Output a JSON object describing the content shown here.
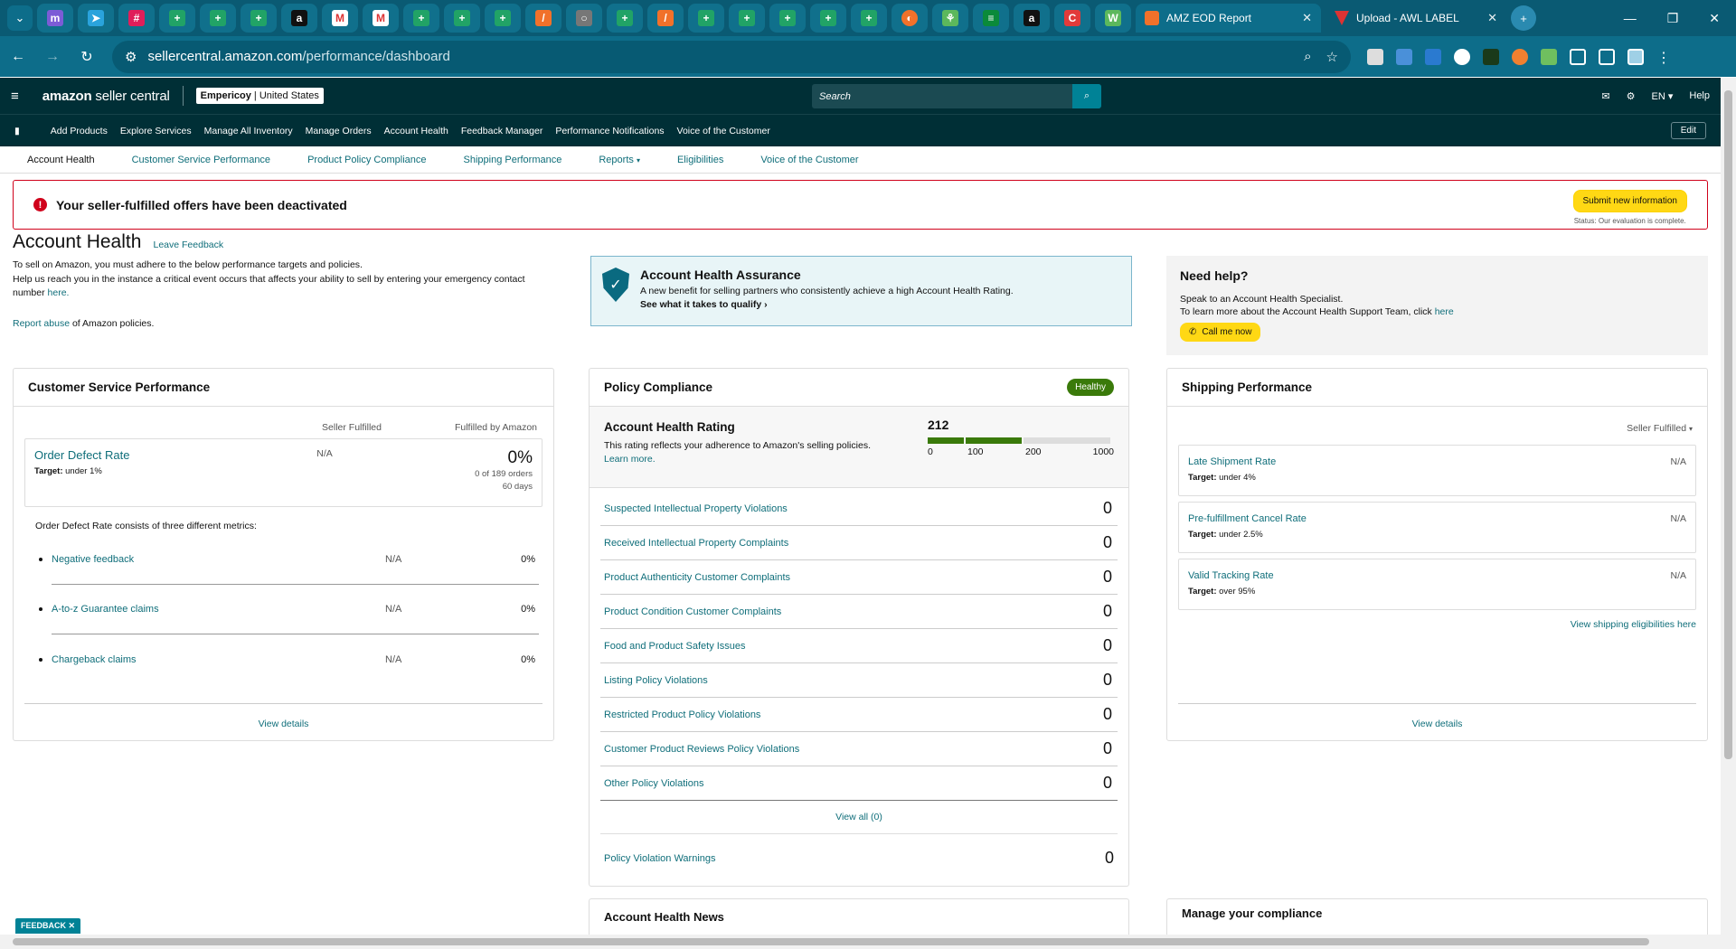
{
  "browser": {
    "tabs": [
      {
        "title": "AMZ EOD Report",
        "active": true
      },
      {
        "title": "Upload - AWL LABEL",
        "active": false
      }
    ],
    "url_domain": "sellercentral.amazon.com",
    "url_path": "/performance/dashboard"
  },
  "header": {
    "logo_main": "amazon",
    "logo_rest": " seller central",
    "account_name": "Empericoy",
    "account_region": "United States",
    "search_placeholder": "Search",
    "language": "EN",
    "help": "Help",
    "nav": [
      "Add Products",
      "Explore Services",
      "Manage All Inventory",
      "Manage Orders",
      "Account Health",
      "Feedback Manager",
      "Performance Notifications",
      "Voice of the Customer"
    ],
    "edit": "Edit"
  },
  "subnav": [
    "Account Health",
    "Customer Service Performance",
    "Product Policy Compliance",
    "Shipping Performance",
    "Reports",
    "Eligibilities",
    "Voice of the Customer"
  ],
  "banner": {
    "message": "Your seller-fulfilled offers have been deactivated",
    "button": "Submit new information",
    "status": "Status: Our evaluation is complete."
  },
  "intro": {
    "title": "Account Health",
    "leave_feedback": "Leave Feedback",
    "line1": "To sell on Amazon, you must adhere to the below performance targets and policies.",
    "line2": "Help us reach you in the instance a critical event occurs that affects your ability to sell by entering your emergency contact number ",
    "here": "here.",
    "report_abuse": "Report abuse",
    "report_rest": " of Amazon policies."
  },
  "aha": {
    "title": "Account Health Assurance",
    "text": "A new benefit for selling partners who consistently achieve a high Account Health Rating.",
    "link": "See what it takes to qualify"
  },
  "help": {
    "title": "Need help?",
    "line1": "Speak to an Account Health Specialist.",
    "line2": "To learn more about the Account Health Support Team, click ",
    "here": "here",
    "call": "Call me now"
  },
  "csp": {
    "title": "Customer Service Performance",
    "col_sf": "Seller Fulfilled",
    "col_fba": "Fulfilled by Amazon",
    "odr_label": "Order Defect Rate",
    "odr_target_label": "Target:",
    "odr_target": " under 1%",
    "odr_sf": "N/A",
    "odr_fba": "0%",
    "odr_orders": "0 of 189 orders",
    "odr_days": "60 days",
    "consists": "Order Defect Rate consists of three different metrics:",
    "metrics": [
      {
        "name": "Negative feedback",
        "sf": "N/A",
        "fba": "0%"
      },
      {
        "name": "A-to-z Guarantee claims",
        "sf": "N/A",
        "fba": "0%"
      },
      {
        "name": "Chargeback claims",
        "sf": "N/A",
        "fba": "0%"
      }
    ],
    "view_details": "View details"
  },
  "policy": {
    "title": "Policy Compliance",
    "badge": "Healthy",
    "ahr_title": "Account Health Rating",
    "ahr_text": "This rating reflects your adherence to Amazon's selling policies. ",
    "learn_more": "Learn more.",
    "score": "212",
    "score_value": 212,
    "tick_labels": [
      "0",
      "100",
      "200",
      "1000"
    ],
    "bar_colors": {
      "low": "#3a7a0a",
      "mid": "#3a7a0a",
      "high": "#dddddd"
    },
    "rows": [
      {
        "label": "Suspected Intellectual Property Violations",
        "value": "0"
      },
      {
        "label": "Received Intellectual Property Complaints",
        "value": "0"
      },
      {
        "label": "Product Authenticity Customer Complaints",
        "value": "0"
      },
      {
        "label": "Product Condition Customer Complaints",
        "value": "0"
      },
      {
        "label": "Food and Product Safety Issues",
        "value": "0"
      },
      {
        "label": "Listing Policy Violations",
        "value": "0"
      },
      {
        "label": "Restricted Product Policy Violations",
        "value": "0"
      },
      {
        "label": "Customer Product Reviews Policy Violations",
        "value": "0"
      },
      {
        "label": "Other Policy Violations",
        "value": "0"
      }
    ],
    "view_all": "View all (0)",
    "warnings_label": "Policy Violation Warnings",
    "warnings_value": "0"
  },
  "shipping": {
    "title": "Shipping Performance",
    "filter": "Seller Fulfilled",
    "metrics": [
      {
        "name": "Late Shipment Rate",
        "target": " under 4%",
        "value": "N/A"
      },
      {
        "name": "Pre-fulfillment Cancel Rate",
        "target": " under 2.5%",
        "value": "N/A"
      },
      {
        "name": "Valid Tracking Rate",
        "target": " over 95%",
        "value": "N/A"
      }
    ],
    "target_label": "Target:",
    "eligibilities": "View shipping eligibilities here",
    "view_details": "View details"
  },
  "news": {
    "title": "Account Health News"
  },
  "manage": {
    "title": "Manage your compliance"
  },
  "feedback": "FEEDBACK"
}
